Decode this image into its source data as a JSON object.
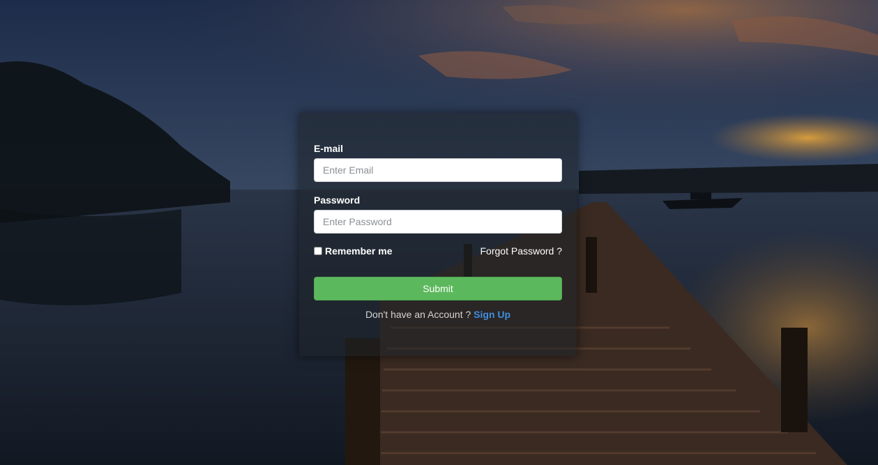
{
  "form": {
    "email_label": "E-mail",
    "email_placeholder": "Enter Email",
    "email_value": "",
    "password_label": "Password",
    "password_placeholder": "Enter Password",
    "password_value": "",
    "remember_label": "Remember me",
    "remember_checked": false,
    "forgot_label": "Forgot Password ?",
    "submit_label": "Submit",
    "signup_prompt": "Don't have an Account ?",
    "signup_label": "Sign Up"
  },
  "colors": {
    "submit": "#5cb85c",
    "link": "#3d8fe0"
  }
}
